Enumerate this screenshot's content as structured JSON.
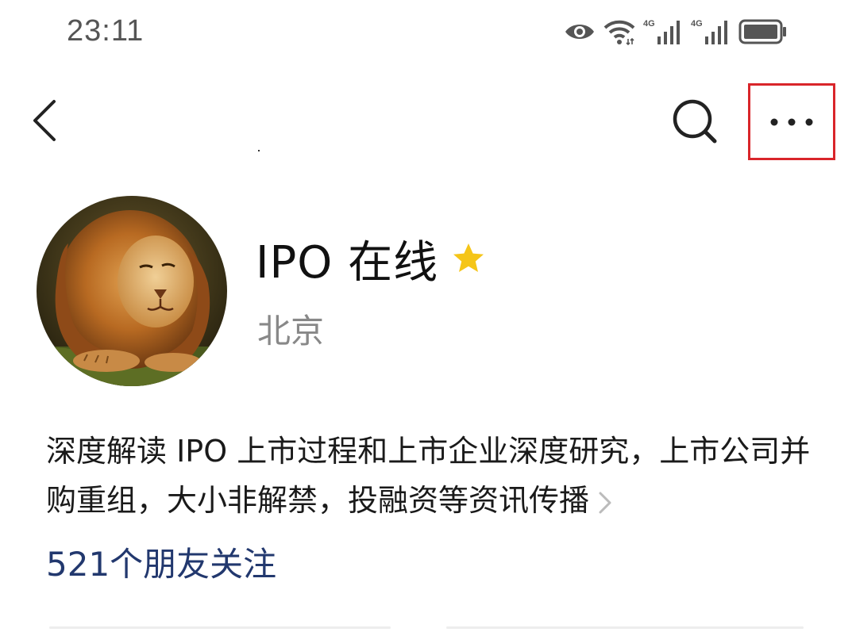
{
  "status_bar": {
    "time": "23:11",
    "icons": [
      "eye-icon",
      "wifi-icon",
      "signal-4g-icon",
      "signal-4g-icon",
      "battery-icon"
    ],
    "network_label_1": "4G",
    "network_label_2": "4G"
  },
  "nav": {
    "back_icon": "chevron-left-icon",
    "search_icon": "search-icon",
    "more_icon": "more-horizontal-icon",
    "highlight_color": "#d9252a"
  },
  "profile": {
    "name": "IPO 在线",
    "verified_icon": "star-icon",
    "star_color": "#f5c518",
    "location": "北京",
    "intro": "深度解读 IPO 上市过程和上市企业深度研究，上市公司并购重组，大小非解禁，投融资等资讯传播",
    "followers": "521个朋友关注",
    "followers_color": "#22386e"
  }
}
